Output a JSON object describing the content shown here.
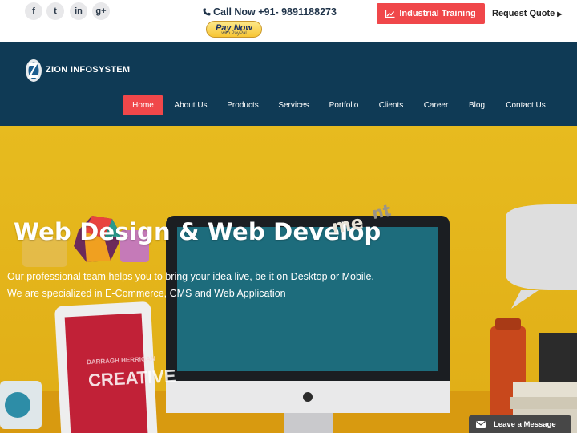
{
  "topbar": {
    "social": [
      {
        "icon": "facebook-icon",
        "glyph": "f"
      },
      {
        "icon": "twitter-icon",
        "glyph": "t"
      },
      {
        "icon": "linkedin-icon",
        "glyph": "in"
      },
      {
        "icon": "google-plus-icon",
        "glyph": "g+"
      }
    ],
    "call_label": "Call Now +91- 9891188273",
    "paynow_label": "Pay Now",
    "paynow_sub": "with PayPal",
    "training_label": "Industrial Training",
    "quote_label": "Request Quote"
  },
  "header": {
    "logo_text": "ZION INFOSYSTEM",
    "nav": [
      {
        "label": "Home",
        "active": true
      },
      {
        "label": "About Us"
      },
      {
        "label": "Products"
      },
      {
        "label": "Services"
      },
      {
        "label": "Portfolio"
      },
      {
        "label": "Clients"
      },
      {
        "label": "Career"
      },
      {
        "label": "Blog"
      },
      {
        "label": "Contact Us"
      }
    ]
  },
  "hero": {
    "title": "Web Design & Web Develop",
    "title_me": "me",
    "title_nt": "nt",
    "line1": "Our professional team helps you to bring your idea live, be it on Desktop or Mobile.",
    "line2": "We are specialized in E-Commerce, CMS and Web Application",
    "tablet_text_small": "DARRAGH HERRIGAN",
    "tablet_text_big": "CREATIVE"
  },
  "chat": {
    "label": "Leave a Message"
  },
  "colors": {
    "accent": "#f0474a",
    "header_bg": "#0f3a55",
    "hero_bg": "#e5b91e"
  }
}
